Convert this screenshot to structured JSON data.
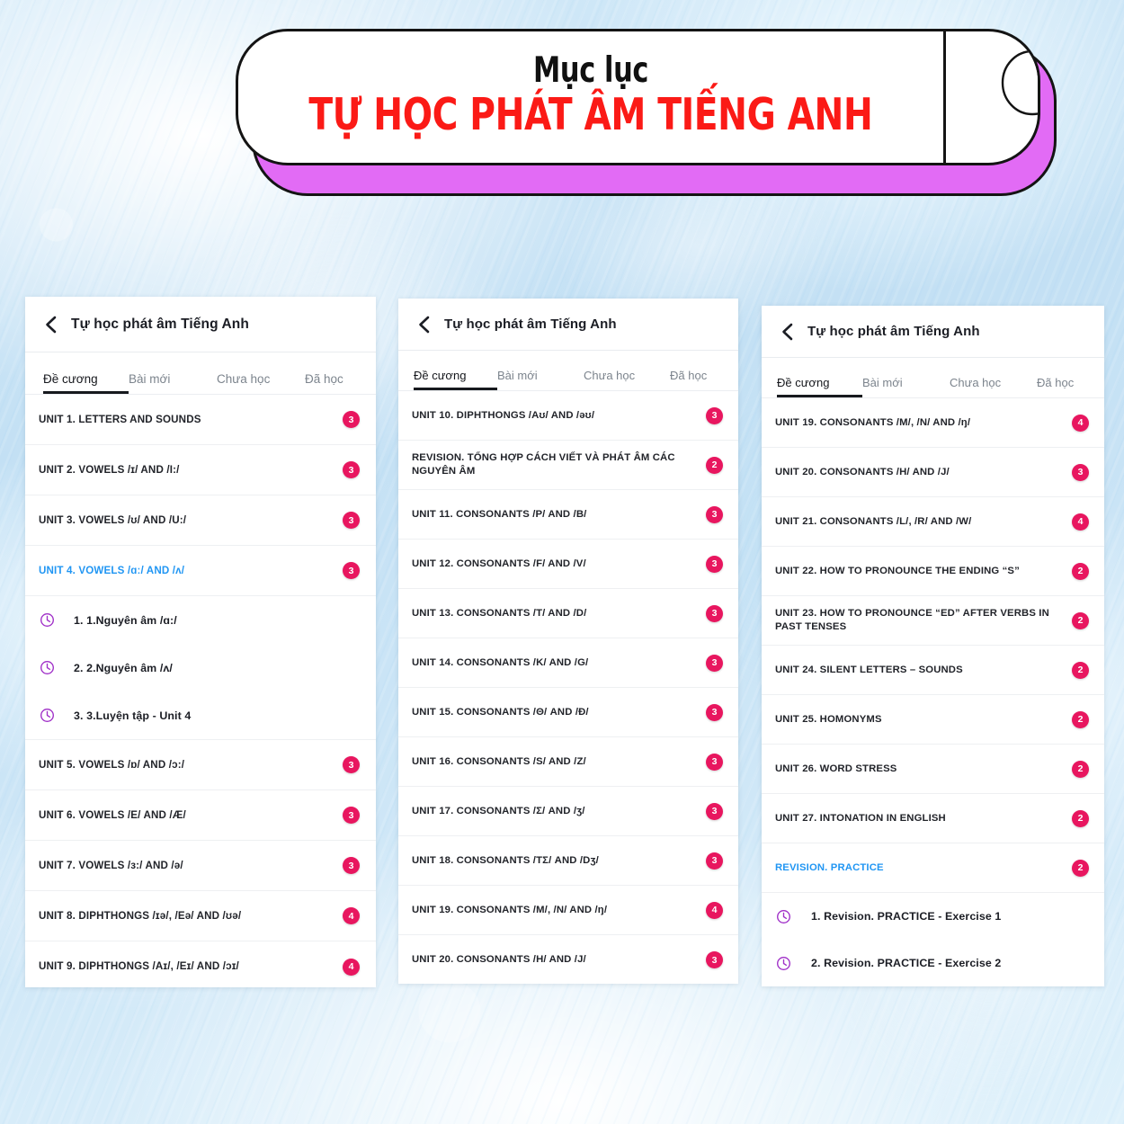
{
  "colors": {
    "badge": "#e8165f",
    "highlight_blue": "#2196f3",
    "banner_title_red": "#fb1a16",
    "banner_shadow_purple": "#e26bf5",
    "clock_purple": "#a030c8",
    "background_blue": "#cfe7f7"
  },
  "banner": {
    "title_top": "Mục lục",
    "title_main": "TỰ HỌC PHÁT ÂM TIẾNG ANH",
    "icon": "magnifying-glass-icon"
  },
  "panels": [
    {
      "header": {
        "back_icon": "chevron-left-icon",
        "title": "Tự học phát âm Tiếng Anh"
      },
      "tabs": [
        {
          "label": "Đề cương",
          "active": true
        },
        {
          "label": "Bài mới",
          "active": false
        },
        {
          "label": "Chưa học",
          "active": false
        },
        {
          "label": "Đã học",
          "active": false
        }
      ],
      "rows": [
        {
          "label": "UNIT 1. LETTERS AND SOUNDS",
          "badge": "3",
          "highlight": false
        },
        {
          "label": "UNIT 2. VOWELS /ɪ/ AND /I:/",
          "badge": "3",
          "highlight": false
        },
        {
          "label": "UNIT 3. VOWELS /ʊ/ AND /U:/",
          "badge": "3",
          "highlight": false
        },
        {
          "label": "UNIT 4. VOWELS /ɑː/ AND /ʌ/",
          "badge": "3",
          "highlight": true
        },
        {
          "label": "UNIT 5. VOWELS /ɒ/ AND /ɔ:/",
          "badge": "3",
          "highlight": false
        },
        {
          "label": "UNIT 6. VOWELS /E/ AND /Æ/",
          "badge": "3",
          "highlight": false
        },
        {
          "label": "UNIT 7. VOWELS /ɜ:/ AND /ə/",
          "badge": "3",
          "highlight": false
        },
        {
          "label": "UNIT 8. DIPHTHONGS /ɪə/, /Eə/ AND /ʊə/",
          "badge": "4",
          "highlight": false
        },
        {
          "label": "UNIT 9. DIPHTHONGS /Aɪ/, /Eɪ/ AND /ɔɪ/",
          "badge": "4",
          "highlight": false
        }
      ],
      "expanded_after_row": 3,
      "sub_items": [
        {
          "icon": "clock-icon",
          "label": "1. 1.Nguyên âm /ɑ:/"
        },
        {
          "icon": "clock-icon",
          "label": "2. 2.Nguyên âm /ʌ/"
        },
        {
          "icon": "clock-icon",
          "label": "3. 3.Luyện tập - Unit 4"
        }
      ]
    },
    {
      "header": {
        "back_icon": "chevron-left-icon",
        "title": "Tự học phát âm Tiếng Anh"
      },
      "tabs": [
        {
          "label": "Đề cương",
          "active": true
        },
        {
          "label": "Bài mới",
          "active": false
        },
        {
          "label": "Chưa học",
          "active": false
        },
        {
          "label": "Đã học",
          "active": false
        }
      ],
      "rows": [
        {
          "label": "UNIT 10. DIPHTHONGS /Aʊ/ AND /əʊ/",
          "badge": "3",
          "highlight": false
        },
        {
          "label": "REVISION. TỔNG HỢP CÁCH VIẾT VÀ PHÁT ÂM CÁC NGUYÊN ÂM",
          "badge": "2",
          "highlight": false
        },
        {
          "label": "UNIT 11. CONSONANTS /P/ AND /B/",
          "badge": "3",
          "highlight": false
        },
        {
          "label": "UNIT 12. CONSONANTS /F/ AND /V/",
          "badge": "3",
          "highlight": false
        },
        {
          "label": "UNIT 13. CONSONANTS /T/ AND /D/",
          "badge": "3",
          "highlight": false
        },
        {
          "label": "UNIT 14. CONSONANTS /K/ AND /G/",
          "badge": "3",
          "highlight": false
        },
        {
          "label": "UNIT 15. CONSONANTS /Θ/ AND /Đ/",
          "badge": "3",
          "highlight": false
        },
        {
          "label": "UNIT 16. CONSONANTS /S/ AND /Z/",
          "badge": "3",
          "highlight": false
        },
        {
          "label": "UNIT 17. CONSONANTS /Σ/ AND /ʒ/",
          "badge": "3",
          "highlight": false
        },
        {
          "label": "UNIT 18. CONSONANTS /TΣ/ AND /Dʒ/",
          "badge": "3",
          "highlight": false
        },
        {
          "label": "UNIT 19. CONSONANTS /M/, /N/ AND /ŋ/",
          "badge": "4",
          "highlight": false
        },
        {
          "label": "UNIT 20. CONSONANTS /H/ AND /J/",
          "badge": "3",
          "highlight": false
        }
      ],
      "expanded_after_row": null,
      "sub_items": []
    },
    {
      "header": {
        "back_icon": "chevron-left-icon",
        "title": "Tự học phát âm Tiếng Anh"
      },
      "tabs": [
        {
          "label": "Đề cương",
          "active": true
        },
        {
          "label": "Bài mới",
          "active": false
        },
        {
          "label": "Chưa học",
          "active": false
        },
        {
          "label": "Đã học",
          "active": false
        }
      ],
      "rows": [
        {
          "label": "UNIT 19. CONSONANTS /M/, /N/ AND /ŋ/",
          "badge": "4",
          "highlight": false
        },
        {
          "label": "UNIT 20. CONSONANTS /H/ AND /J/",
          "badge": "3",
          "highlight": false
        },
        {
          "label": "UNIT 21. CONSONANTS /L/, /R/ AND /W/",
          "badge": "4",
          "highlight": false
        },
        {
          "label": "UNIT 22. HOW TO PRONOUNCE THE ENDING “S”",
          "badge": "2",
          "highlight": false
        },
        {
          "label": "UNIT 23. HOW TO PRONOUNCE “ED” AFTER VERBS IN PAST TENSES",
          "badge": "2",
          "highlight": false
        },
        {
          "label": "UNIT 24. SILENT LETTERS – SOUNDS",
          "badge": "2",
          "highlight": false
        },
        {
          "label": "UNIT 25. HOMONYMS",
          "badge": "2",
          "highlight": false
        },
        {
          "label": "UNIT 26. WORD STRESS",
          "badge": "2",
          "highlight": false
        },
        {
          "label": "UNIT 27. INTONATION IN ENGLISH",
          "badge": "2",
          "highlight": false
        },
        {
          "label": "REVISION. PRACTICE",
          "badge": "2",
          "highlight": true
        }
      ],
      "expanded_after_row": 9,
      "sub_items": [
        {
          "icon": "clock-icon",
          "label": "1. Revision. PRACTICE - Exercise 1"
        },
        {
          "icon": "clock-icon",
          "label": "2. Revision. PRACTICE - Exercise 2"
        }
      ]
    }
  ]
}
